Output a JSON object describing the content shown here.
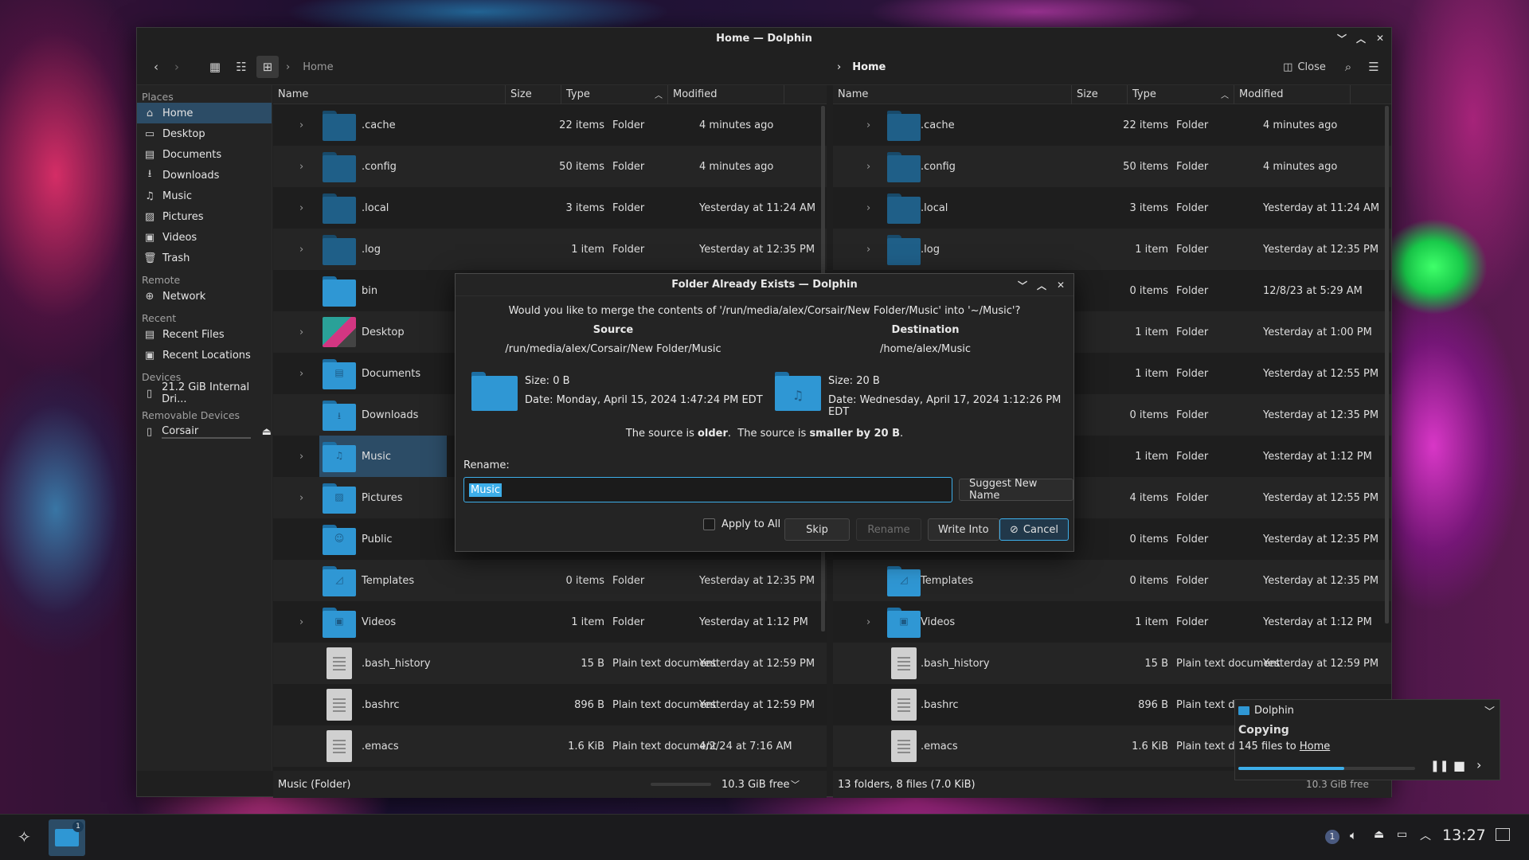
{
  "window": {
    "title": "Home — Dolphin"
  },
  "left_pane": {
    "breadcrumb": "Home",
    "columns": {
      "name": "Name",
      "size": "Size",
      "type": "Type",
      "modified": "Modified"
    },
    "rows": [
      {
        "name": ".cache",
        "size": "22 items",
        "type": "Folder",
        "modified": "4 minutes ago",
        "kind": "folder-dim",
        "expandable": true
      },
      {
        "name": ".config",
        "size": "50 items",
        "type": "Folder",
        "modified": "4 minutes ago",
        "kind": "folder-dim",
        "expandable": true
      },
      {
        "name": ".local",
        "size": "3 items",
        "type": "Folder",
        "modified": "Yesterday at 11:24 AM",
        "kind": "folder-dim",
        "expandable": true
      },
      {
        "name": ".log",
        "size": "1 item",
        "type": "Folder",
        "modified": "Yesterday at 12:35 PM",
        "kind": "folder-dim",
        "expandable": true
      },
      {
        "name": "bin",
        "size": "",
        "type": "",
        "modified": "",
        "kind": "folder",
        "expandable": false
      },
      {
        "name": "Desktop",
        "size": "",
        "type": "",
        "modified": "",
        "kind": "desktop",
        "expandable": true
      },
      {
        "name": "Documents",
        "size": "",
        "type": "",
        "modified": "",
        "kind": "folder",
        "expandable": true
      },
      {
        "name": "Downloads",
        "size": "",
        "type": "",
        "modified": "",
        "kind": "folder",
        "expandable": false
      },
      {
        "name": "Music",
        "size": "",
        "type": "",
        "modified": "",
        "kind": "folder",
        "expandable": true,
        "selected": true
      },
      {
        "name": "Pictures",
        "size": "",
        "type": "",
        "modified": "",
        "kind": "folder",
        "expandable": true
      },
      {
        "name": "Public",
        "size": "",
        "type": "",
        "modified": "",
        "kind": "folder",
        "expandable": false
      },
      {
        "name": "Templates",
        "size": "0 items",
        "type": "Folder",
        "modified": "Yesterday at 12:35 PM",
        "kind": "folder",
        "expandable": false
      },
      {
        "name": "Videos",
        "size": "1 item",
        "type": "Folder",
        "modified": "Yesterday at 1:12 PM",
        "kind": "folder",
        "expandable": true
      },
      {
        "name": ".bash_history",
        "size": "15 B",
        "type": "Plain text document",
        "modified": "Yesterday at 12:59 PM",
        "kind": "doc",
        "expandable": false
      },
      {
        "name": ".bashrc",
        "size": "896 B",
        "type": "Plain text document",
        "modified": "Yesterday at 12:59 PM",
        "kind": "doc",
        "expandable": false
      },
      {
        "name": ".emacs",
        "size": "1.6 KiB",
        "type": "Plain text document",
        "modified": "4/2/24 at 7:16 AM",
        "kind": "doc",
        "expandable": false
      }
    ],
    "status": "Music (Folder)",
    "free": "10.3 GiB free"
  },
  "right_pane": {
    "breadcrumb": "Home",
    "close_label": "Close",
    "columns": {
      "name": "Name",
      "size": "Size",
      "type": "Type",
      "modified": "Modified"
    },
    "rows": [
      {
        "name": ".cache",
        "size": "22 items",
        "type": "Folder",
        "modified": "4 minutes ago",
        "kind": "folder-dim",
        "expandable": true
      },
      {
        "name": ".config",
        "size": "50 items",
        "type": "Folder",
        "modified": "4 minutes ago",
        "kind": "folder-dim",
        "expandable": true
      },
      {
        "name": ".local",
        "size": "3 items",
        "type": "Folder",
        "modified": "Yesterday at 11:24 AM",
        "kind": "folder-dim",
        "expandable": true
      },
      {
        "name": ".log",
        "size": "1 item",
        "type": "Folder",
        "modified": "Yesterday at 12:35 PM",
        "kind": "folder-dim",
        "expandable": true
      },
      {
        "name": "",
        "size": "0 items",
        "type": "Folder",
        "modified": "12/8/23 at 5:29 AM",
        "kind": "none",
        "expandable": false
      },
      {
        "name": "",
        "size": "1 item",
        "type": "Folder",
        "modified": "Yesterday at 1:00 PM",
        "kind": "none",
        "expandable": false
      },
      {
        "name": "",
        "size": "1 item",
        "type": "Folder",
        "modified": "Yesterday at 12:55 PM",
        "kind": "none",
        "expandable": false
      },
      {
        "name": "",
        "size": "0 items",
        "type": "Folder",
        "modified": "Yesterday at 12:35 PM",
        "kind": "none",
        "expandable": false
      },
      {
        "name": "",
        "size": "1 item",
        "type": "Folder",
        "modified": "Yesterday at 1:12 PM",
        "kind": "none",
        "expandable": false
      },
      {
        "name": "",
        "size": "4 items",
        "type": "Folder",
        "modified": "Yesterday at 12:55 PM",
        "kind": "none",
        "expandable": false
      },
      {
        "name": "",
        "size": "0 items",
        "type": "Folder",
        "modified": "Yesterday at 12:35 PM",
        "kind": "none",
        "expandable": false
      },
      {
        "name": "Templates",
        "size": "0 items",
        "type": "Folder",
        "modified": "Yesterday at 12:35 PM",
        "kind": "folder",
        "expandable": false
      },
      {
        "name": "Videos",
        "size": "1 item",
        "type": "Folder",
        "modified": "Yesterday at 1:12 PM",
        "kind": "folder",
        "expandable": true
      },
      {
        "name": ".bash_history",
        "size": "15 B",
        "type": "Plain text document",
        "modified": "Yesterday at 12:59 PM",
        "kind": "doc",
        "expandable": false
      },
      {
        "name": ".bashrc",
        "size": "896 B",
        "type": "Plain text documen",
        "modified": "",
        "kind": "doc",
        "expandable": false
      },
      {
        "name": ".emacs",
        "size": "1.6 KiB",
        "type": "Plain text documen",
        "modified": "",
        "kind": "doc",
        "expandable": false
      }
    ],
    "status": "13 folders, 8 files (7.0 KiB)",
    "free": "10.3 GiB free"
  },
  "places": {
    "sections": [
      {
        "title": "Places",
        "items": [
          {
            "label": "Home",
            "icon": "home-icon",
            "selected": true
          },
          {
            "label": "Desktop",
            "icon": "desktop-icon"
          },
          {
            "label": "Documents",
            "icon": "documents-icon"
          },
          {
            "label": "Downloads",
            "icon": "downloads-icon"
          },
          {
            "label": "Music",
            "icon": "music-icon"
          },
          {
            "label": "Pictures",
            "icon": "pictures-icon"
          },
          {
            "label": "Videos",
            "icon": "videos-icon"
          },
          {
            "label": "Trash",
            "icon": "trash-icon"
          }
        ]
      },
      {
        "title": "Remote",
        "items": [
          {
            "label": "Network",
            "icon": "network-icon"
          }
        ]
      },
      {
        "title": "Recent",
        "items": [
          {
            "label": "Recent Files",
            "icon": "recent-files-icon"
          },
          {
            "label": "Recent Locations",
            "icon": "recent-locations-icon"
          }
        ]
      },
      {
        "title": "Devices",
        "items": [
          {
            "label": "21.2 GiB Internal Dri...",
            "icon": "drive-icon"
          }
        ]
      },
      {
        "title": "Removable Devices",
        "items": [
          {
            "label": "Corsair",
            "icon": "usb-icon",
            "eject": true
          }
        ]
      }
    ]
  },
  "dialog": {
    "title": "Folder Already Exists — Dolphin",
    "question": "Would you like to merge the contents of '/run/media/alex/Corsair/New Folder/Music' into '~/Music'?",
    "source": {
      "heading": "Source",
      "path": "/run/media/alex/Corsair/New Folder/Music",
      "size": "Size: 0 B",
      "date": "Date: Monday, April 15, 2024 1:47:24 PM EDT"
    },
    "destination": {
      "heading": "Destination",
      "path": "/home/alex/Music",
      "size": "Size: 20 B",
      "date": "Date: Wednesday, April 17, 2024 1:12:26 PM EDT"
    },
    "comparison": {
      "p1": "The source is ",
      "b1": "older",
      "p2": ".  The source is ",
      "b2": "smaller by 20 B",
      "p3": "."
    },
    "rename_label": "Rename:",
    "rename_value": "Music",
    "suggest_label": "Suggest New Name",
    "apply_all_label": "Apply to All",
    "skip_label": "Skip",
    "rename_button": "Rename",
    "write_into_label": "Write Into",
    "cancel_label": "Cancel"
  },
  "notification": {
    "app": "Dolphin",
    "title": "Copying",
    "text_prefix": "145 files to ",
    "link": "Home",
    "free": "10.3 GiB free",
    "progress": 0.6
  },
  "panel": {
    "clock": "13:27",
    "task_badge": "1",
    "notif_count": "1"
  },
  "colors": {
    "accent": "#3daee9",
    "selection": "#2c4c66",
    "folder": "#2f97d4"
  }
}
